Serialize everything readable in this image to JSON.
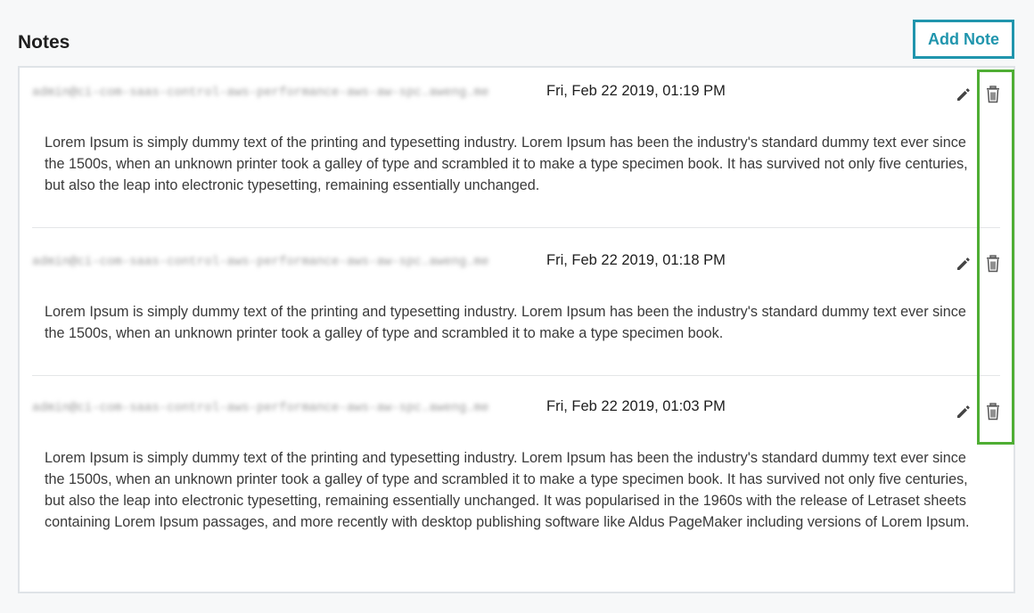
{
  "header": {
    "title": "Notes",
    "add_note_label": "Add Note"
  },
  "notes": [
    {
      "author": "admin@ci-com-saas-control-aws-performance-aws-aw-spc.aweng.me",
      "timestamp": "Fri, Feb 22 2019, 01:19 PM",
      "body": "Lorem Ipsum is simply dummy text of the printing and typesetting industry. Lorem Ipsum has been the industry's standard dummy text ever since the 1500s, when an unknown printer took a galley of type and scrambled it to make a type specimen book. It has survived not only five centuries, but also the leap into electronic typesetting, remaining essentially unchanged."
    },
    {
      "author": "admin@ci-com-saas-control-aws-performance-aws-aw-spc.aweng.me",
      "timestamp": "Fri, Feb 22 2019, 01:18 PM",
      "body": "Lorem Ipsum is simply dummy text of the printing and typesetting industry. Lorem Ipsum has been the industry's standard dummy text ever since the 1500s, when an unknown printer took a galley of type and scrambled it to make a type specimen book."
    },
    {
      "author": "admin@ci-com-saas-control-aws-performance-aws-aw-spc.aweng.me",
      "timestamp": "Fri, Feb 22 2019, 01:03 PM",
      "body": "Lorem Ipsum is simply dummy text of the printing and typesetting industry. Lorem Ipsum has been the industry's standard dummy text ever since the 1500s, when an unknown printer took a galley of type and scrambled it to make a type specimen book. It has survived not only five centuries, but also the leap into electronic typesetting, remaining essentially unchanged. It was popularised in the 1960s with the release of Letraset sheets containing Lorem Ipsum passages, and more recently with desktop publishing software like Aldus PageMaker including versions of Lorem Ipsum."
    }
  ],
  "icons": {
    "edit": "pencil-icon",
    "delete": "trash-icon"
  },
  "colors": {
    "accent": "#2095ad",
    "highlight": "#4fae34",
    "panel_border": "#dfe3e7",
    "divider": "#e4e6e8"
  }
}
